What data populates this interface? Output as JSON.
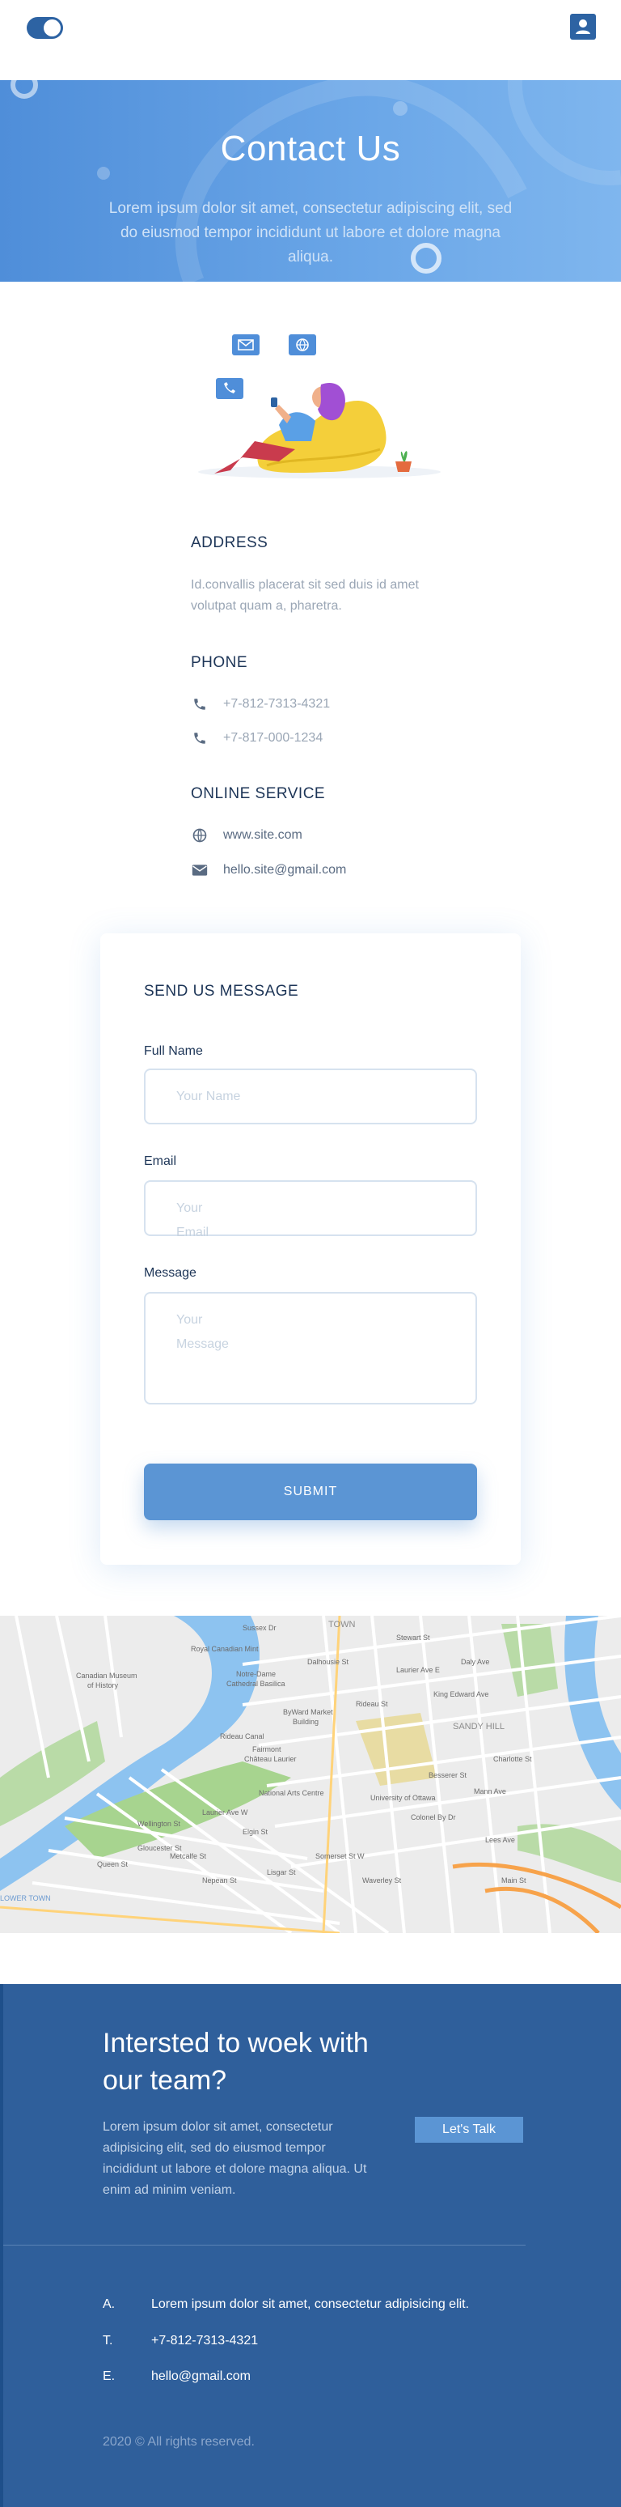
{
  "header": {
    "toggle_icon": "theme-toggle-icon",
    "user_icon": "user-icon"
  },
  "hero": {
    "title": "Contact Us",
    "subtitle": "Lorem ipsum dolor sit amet, consectetur adipiscing elit, sed do eiusmod tempor incididunt ut labore et dolore magna aliqua."
  },
  "contact_info": {
    "address_heading": "ADDRESS",
    "address_text": "Id.convallis placerat sit sed duis id amet volutpat quam a, pharetra.",
    "phone_heading": "PHONE",
    "phones": [
      "+7-812-7313-4321",
      "+7-817-000-1234"
    ],
    "online_heading": "ONLINE SERVICE",
    "website": "www.site.com",
    "email": "hello.site@gmail.com"
  },
  "form": {
    "title": "SEND US MESSAGE",
    "full_name_label": "Full Name",
    "full_name_placeholder": "Your Name",
    "email_label": "Email",
    "email_placeholder": "Your Email",
    "message_label": "Message",
    "message_placeholder": "Your Message",
    "submit_label": "SUBMIT"
  },
  "map": {
    "labels": [
      "Canadian Museum of History",
      "Royal Canadian Mint",
      "Notre-Dame Cathedral Basilica",
      "ByWard Market Building",
      "Rideau Canal",
      "Fairmont Château Laurier",
      "National Arts Centre",
      "University of Ottawa",
      "SANDY HILL",
      "TOWN",
      "LOWER TOWN",
      "Laurier Ave E",
      "Wellington St",
      "King Edward Ave",
      "Laurier Ave W",
      "Somerset St W",
      "Gloucester St",
      "Queen St",
      "Nepean St",
      "Elgin St",
      "Metcalfe St",
      "Waverley St",
      "Rideau St",
      "Dalhousie St",
      "Sussex Dr",
      "Daly Ave",
      "Besserer St",
      "Mann Ave",
      "Charlotte St",
      "Lees Ave",
      "Colonel By Dr",
      "Main St",
      "Stewart St",
      "Lisgar St"
    ]
  },
  "footer": {
    "title": "Intersted to woek with our team?",
    "text": "Lorem ipsum dolor sit amet, consectetur adipisicing elit, sed do eiusmod tempor incididunt ut labore et dolore magna aliqua. Ut enim ad minim veniam.",
    "cta_label": "Let's Talk",
    "address_key": "A.",
    "address_value": "Lorem ipsum dolor sit amet, consectetur adipisicing elit.",
    "phone_key": "T.",
    "phone_value": "+7-812-7313-4321",
    "email_key": "E.",
    "email_value": "hello@gmail.com",
    "copyright": "2020 © All rights reserved."
  },
  "colors": {
    "brand": "#2d63a3",
    "accent": "#5b95d4",
    "hero_gradient_start": "#4f8ed9",
    "hero_gradient_end": "#7fb6ee",
    "footer_bg": "#2f5f9b"
  }
}
